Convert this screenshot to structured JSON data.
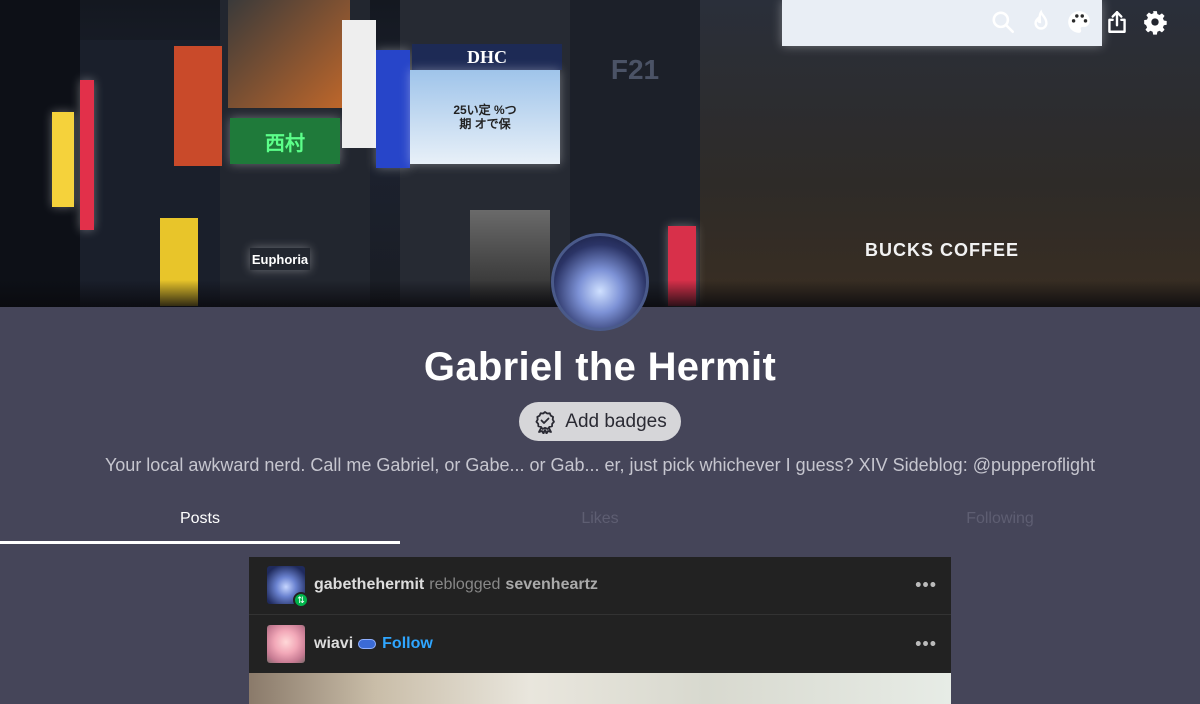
{
  "header": {
    "signs": {
      "dhc": "DHC",
      "euphoria": "Euphoria",
      "coffee": "BUCKS COFFEE",
      "forever": "F21",
      "store": "西村",
      "screen": "25い定 %つ期 オで保"
    },
    "toolbar": [
      {
        "name": "search-icon"
      },
      {
        "name": "activity-icon"
      },
      {
        "name": "palette-icon"
      },
      {
        "name": "share-icon"
      },
      {
        "name": "settings-icon"
      }
    ]
  },
  "profile": {
    "title": "Gabriel the Hermit",
    "badges_label": "Add badges",
    "bio": "Your local awkward nerd. Call me Gabriel, or Gabe... or Gab... er, just pick whichever I guess? XIV Sideblog: @pupperoflight"
  },
  "tabs": [
    {
      "label": "Posts",
      "active": true
    },
    {
      "label": "Likes",
      "active": false
    },
    {
      "label": "Following",
      "active": false
    }
  ],
  "post": {
    "reblogger": "gabethehermit",
    "action": "reblogged",
    "source": "sevenheartz",
    "author": "wiavi",
    "follow_label": "Follow",
    "more": "•••"
  },
  "colors": {
    "background": "#454559",
    "accent": "#2fa6ff",
    "reblog_green": "#00b34a",
    "card": "#222222"
  }
}
